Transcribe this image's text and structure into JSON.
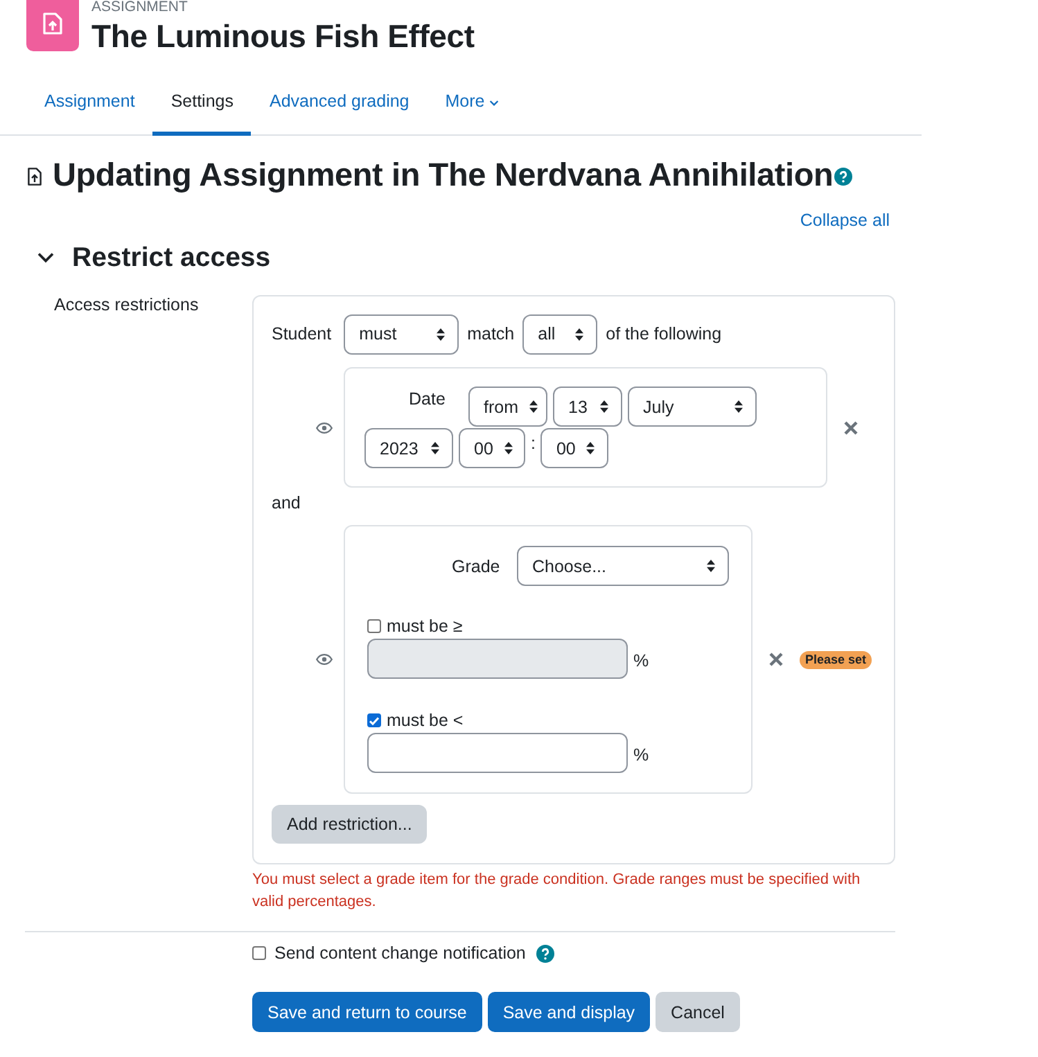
{
  "header": {
    "context": "ASSIGNMENT",
    "title": "The Luminous Fish Effect"
  },
  "tabs": [
    {
      "label": "Assignment",
      "selected": false
    },
    {
      "label": "Settings",
      "selected": true
    },
    {
      "label": "Advanced grading",
      "selected": false
    },
    {
      "label": "More",
      "selected": false,
      "kind": "menu"
    }
  ],
  "page_heading": "Updating Assignment in The Nerdvana Annihilation",
  "collapse_link": "Collapse all",
  "section": {
    "title": "Restrict access",
    "expanded": true,
    "field_label": "Access restrictions",
    "match_row": {
      "prefix": "Student",
      "requirement": "must",
      "middle": "match",
      "scope": "all",
      "suffix": "of the following"
    },
    "conditions": [
      {
        "kind": "date",
        "shown": true,
        "label": "Date",
        "parts": [
          {
            "kind": "select",
            "value": "from"
          },
          {
            "kind": "select",
            "value": "13"
          },
          {
            "kind": "select",
            "value": "July"
          },
          {
            "kind": "select",
            "value": "2023"
          },
          {
            "kind": "select",
            "value": "00"
          },
          {
            "kind": "separator",
            "text": ":"
          },
          {
            "kind": "select",
            "value": "00"
          }
        ]
      },
      {
        "kind": "grade",
        "joiner": "and",
        "shown": true,
        "label": "Grade",
        "item": "Choose...",
        "bounds": [
          {
            "label": "must be ≥",
            "checked": false,
            "unit": "%"
          },
          {
            "label": "must be <",
            "checked": true,
            "unit": "%"
          }
        ],
        "badge": "Please set"
      }
    ],
    "add_button": "Add restriction...",
    "error": "You must select a grade item for the grade condition. Grade ranges must be specified with valid percentages."
  },
  "notification": {
    "label": "Send content change notification",
    "checked": false
  },
  "buttons": [
    {
      "label": "Save and return to course",
      "kind": "primary"
    },
    {
      "label": "Save and display",
      "kind": "primary"
    },
    {
      "label": "Cancel",
      "kind": "secondary"
    }
  ]
}
